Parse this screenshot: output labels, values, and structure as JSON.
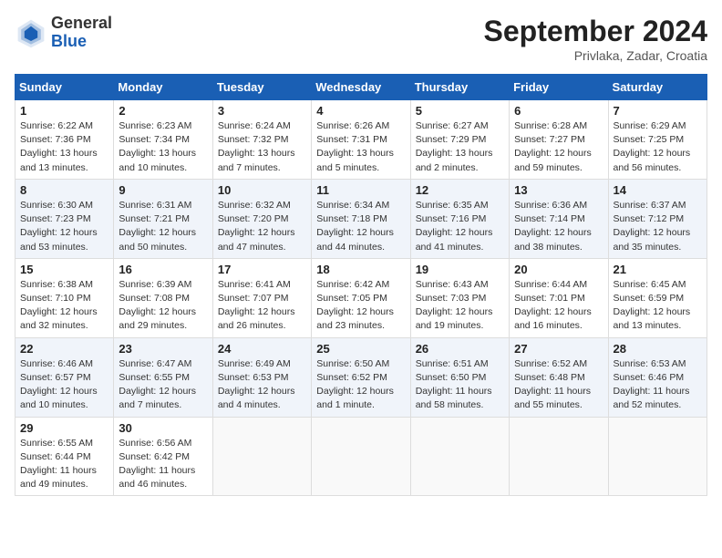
{
  "header": {
    "logo_general": "General",
    "logo_blue": "Blue",
    "month_title": "September 2024",
    "subtitle": "Privlaka, Zadar, Croatia"
  },
  "calendar": {
    "days_of_week": [
      "Sunday",
      "Monday",
      "Tuesday",
      "Wednesday",
      "Thursday",
      "Friday",
      "Saturday"
    ],
    "weeks": [
      [
        {
          "day": "1",
          "detail": "Sunrise: 6:22 AM\nSunset: 7:36 PM\nDaylight: 13 hours\nand 13 minutes."
        },
        {
          "day": "2",
          "detail": "Sunrise: 6:23 AM\nSunset: 7:34 PM\nDaylight: 13 hours\nand 10 minutes."
        },
        {
          "day": "3",
          "detail": "Sunrise: 6:24 AM\nSunset: 7:32 PM\nDaylight: 13 hours\nand 7 minutes."
        },
        {
          "day": "4",
          "detail": "Sunrise: 6:26 AM\nSunset: 7:31 PM\nDaylight: 13 hours\nand 5 minutes."
        },
        {
          "day": "5",
          "detail": "Sunrise: 6:27 AM\nSunset: 7:29 PM\nDaylight: 13 hours\nand 2 minutes."
        },
        {
          "day": "6",
          "detail": "Sunrise: 6:28 AM\nSunset: 7:27 PM\nDaylight: 12 hours\nand 59 minutes."
        },
        {
          "day": "7",
          "detail": "Sunrise: 6:29 AM\nSunset: 7:25 PM\nDaylight: 12 hours\nand 56 minutes."
        }
      ],
      [
        {
          "day": "8",
          "detail": "Sunrise: 6:30 AM\nSunset: 7:23 PM\nDaylight: 12 hours\nand 53 minutes."
        },
        {
          "day": "9",
          "detail": "Sunrise: 6:31 AM\nSunset: 7:21 PM\nDaylight: 12 hours\nand 50 minutes."
        },
        {
          "day": "10",
          "detail": "Sunrise: 6:32 AM\nSunset: 7:20 PM\nDaylight: 12 hours\nand 47 minutes."
        },
        {
          "day": "11",
          "detail": "Sunrise: 6:34 AM\nSunset: 7:18 PM\nDaylight: 12 hours\nand 44 minutes."
        },
        {
          "day": "12",
          "detail": "Sunrise: 6:35 AM\nSunset: 7:16 PM\nDaylight: 12 hours\nand 41 minutes."
        },
        {
          "day": "13",
          "detail": "Sunrise: 6:36 AM\nSunset: 7:14 PM\nDaylight: 12 hours\nand 38 minutes."
        },
        {
          "day": "14",
          "detail": "Sunrise: 6:37 AM\nSunset: 7:12 PM\nDaylight: 12 hours\nand 35 minutes."
        }
      ],
      [
        {
          "day": "15",
          "detail": "Sunrise: 6:38 AM\nSunset: 7:10 PM\nDaylight: 12 hours\nand 32 minutes."
        },
        {
          "day": "16",
          "detail": "Sunrise: 6:39 AM\nSunset: 7:08 PM\nDaylight: 12 hours\nand 29 minutes."
        },
        {
          "day": "17",
          "detail": "Sunrise: 6:41 AM\nSunset: 7:07 PM\nDaylight: 12 hours\nand 26 minutes."
        },
        {
          "day": "18",
          "detail": "Sunrise: 6:42 AM\nSunset: 7:05 PM\nDaylight: 12 hours\nand 23 minutes."
        },
        {
          "day": "19",
          "detail": "Sunrise: 6:43 AM\nSunset: 7:03 PM\nDaylight: 12 hours\nand 19 minutes."
        },
        {
          "day": "20",
          "detail": "Sunrise: 6:44 AM\nSunset: 7:01 PM\nDaylight: 12 hours\nand 16 minutes."
        },
        {
          "day": "21",
          "detail": "Sunrise: 6:45 AM\nSunset: 6:59 PM\nDaylight: 12 hours\nand 13 minutes."
        }
      ],
      [
        {
          "day": "22",
          "detail": "Sunrise: 6:46 AM\nSunset: 6:57 PM\nDaylight: 12 hours\nand 10 minutes."
        },
        {
          "day": "23",
          "detail": "Sunrise: 6:47 AM\nSunset: 6:55 PM\nDaylight: 12 hours\nand 7 minutes."
        },
        {
          "day": "24",
          "detail": "Sunrise: 6:49 AM\nSunset: 6:53 PM\nDaylight: 12 hours\nand 4 minutes."
        },
        {
          "day": "25",
          "detail": "Sunrise: 6:50 AM\nSunset: 6:52 PM\nDaylight: 12 hours\nand 1 minute."
        },
        {
          "day": "26",
          "detail": "Sunrise: 6:51 AM\nSunset: 6:50 PM\nDaylight: 11 hours\nand 58 minutes."
        },
        {
          "day": "27",
          "detail": "Sunrise: 6:52 AM\nSunset: 6:48 PM\nDaylight: 11 hours\nand 55 minutes."
        },
        {
          "day": "28",
          "detail": "Sunrise: 6:53 AM\nSunset: 6:46 PM\nDaylight: 11 hours\nand 52 minutes."
        }
      ],
      [
        {
          "day": "29",
          "detail": "Sunrise: 6:55 AM\nSunset: 6:44 PM\nDaylight: 11 hours\nand 49 minutes."
        },
        {
          "day": "30",
          "detail": "Sunrise: 6:56 AM\nSunset: 6:42 PM\nDaylight: 11 hours\nand 46 minutes."
        },
        {
          "day": "",
          "detail": ""
        },
        {
          "day": "",
          "detail": ""
        },
        {
          "day": "",
          "detail": ""
        },
        {
          "day": "",
          "detail": ""
        },
        {
          "day": "",
          "detail": ""
        }
      ]
    ]
  }
}
